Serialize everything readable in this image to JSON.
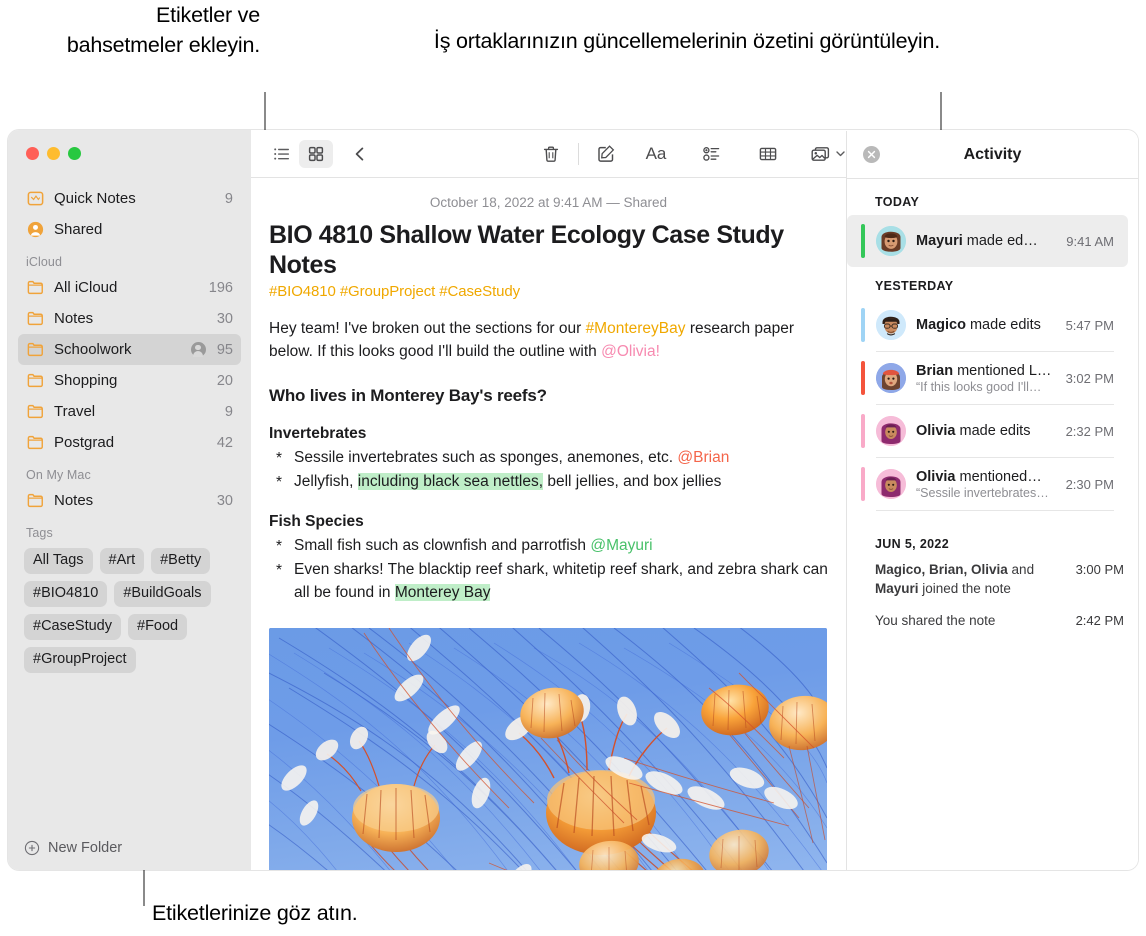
{
  "callouts": {
    "tags": "Etiketler ve bahsetmeler ekleyin.",
    "activity": "İş ortaklarınızın güncellemelerinin özetini görüntüleyin.",
    "browse": "Etiketlerinize göz atın."
  },
  "sidebar": {
    "top_items": [
      {
        "label": "Quick Notes",
        "count": "9",
        "icon": "quick-note-icon"
      },
      {
        "label": "Shared",
        "count": "",
        "icon": "shared-person-icon"
      }
    ],
    "sections": [
      {
        "header": "iCloud",
        "items": [
          {
            "label": "All iCloud",
            "count": "196",
            "icon": "folder-icon",
            "shared": false,
            "selected": false
          },
          {
            "label": "Notes",
            "count": "30",
            "icon": "folder-icon",
            "shared": false,
            "selected": false
          },
          {
            "label": "Schoolwork",
            "count": "95",
            "icon": "folder-icon",
            "shared": true,
            "selected": true
          },
          {
            "label": "Shopping",
            "count": "20",
            "icon": "folder-icon",
            "shared": false,
            "selected": false
          },
          {
            "label": "Travel",
            "count": "9",
            "icon": "folder-icon",
            "shared": false,
            "selected": false
          },
          {
            "label": "Postgrad",
            "count": "42",
            "icon": "folder-icon",
            "shared": false,
            "selected": false
          }
        ]
      },
      {
        "header": "On My Mac",
        "items": [
          {
            "label": "Notes",
            "count": "30",
            "icon": "folder-icon",
            "shared": false,
            "selected": false
          }
        ]
      }
    ],
    "tags_header": "Tags",
    "tags": [
      "All Tags",
      "#Art",
      "#Betty",
      "#BIO4810",
      "#BuildGoals",
      "#CaseStudy",
      "#Food",
      "#GroupProject"
    ],
    "new_folder_label": "New Folder"
  },
  "toolbar": {
    "list_view": "list-view-icon",
    "grid_view": "grid-view-icon",
    "back": "back-chevron-icon",
    "delete": "trash-icon",
    "compose": "compose-icon",
    "format": "Aa",
    "checklist": "checklist-icon",
    "table": "table-icon",
    "media": "media-icon",
    "link": "link-icon",
    "lock": "lock-icon",
    "collaborate": "add-person-icon",
    "share": "share-icon",
    "search": "search-icon"
  },
  "note": {
    "date": "October 18, 2022 at 9:41 AM — Shared",
    "title": "BIO 4810 Shallow Water Ecology Case Study Notes",
    "tags_line": "#BIO4810 #GroupProject #CaseStudy",
    "intro": {
      "part1": "Hey team! I've broken out the sections for our ",
      "tag": "#MontereyBay",
      "part2": " research paper below. If this looks good I'll build the outline with ",
      "mention": "@Olivia!"
    },
    "heading": "Who lives in Monterey Bay's reefs?",
    "sections": [
      {
        "subhead": "Invertebrates",
        "bullets": [
          {
            "pre": "Sessile invertebrates such as sponges, anemones, etc. ",
            "mention": "@Brian",
            "mention_color": "red",
            "post": ""
          },
          {
            "pre": "Jellyfish, ",
            "highlight": "including black sea nettles,",
            "post": " bell jellies, and box jellies"
          }
        ]
      },
      {
        "subhead": "Fish Species",
        "bullets": [
          {
            "pre": "Small fish such as clownfish and parrotfish ",
            "mention": "@Mayuri",
            "mention_color": "green",
            "post": ""
          },
          {
            "pre": "Even sharks! The blacktip reef shark, whitetip reef shark, and zebra shark can all be found in ",
            "highlight": "Monterey Bay",
            "post": ""
          }
        ]
      }
    ],
    "photo_alt": "jellyfish-photo"
  },
  "activity": {
    "title": "Activity",
    "close": "close-icon",
    "groups": [
      {
        "title": "TODAY",
        "entries": [
          {
            "type": "avatar",
            "name": "Mayuri",
            "action": " made ed…",
            "quote": "",
            "time": "9:41 AM",
            "bar_color": "#34c759",
            "avatar_bg": "#a8dfe6",
            "selected": true,
            "divider": false
          }
        ]
      },
      {
        "title": "YESTERDAY",
        "entries": [
          {
            "type": "avatar",
            "name": "Magico",
            "action": " made edits",
            "quote": "",
            "time": "5:47 PM",
            "bar_color": "#9fd4f5",
            "avatar_bg": "#cfe9fb",
            "selected": false,
            "divider": true
          },
          {
            "type": "avatar",
            "name": "Brian",
            "action": " mentioned L…",
            "quote": "“If this looks good I'll…",
            "time": "3:02 PM",
            "bar_color": "#f4543c",
            "avatar_bg": "#8fa8e8",
            "selected": false,
            "divider": true
          },
          {
            "type": "avatar",
            "name": "Olivia",
            "action": " made edits",
            "quote": "",
            "time": "2:32 PM",
            "bar_color": "#f9aac8",
            "avatar_bg": "#f6bcd8",
            "selected": false,
            "divider": true
          },
          {
            "type": "avatar",
            "name": "Olivia",
            "action": " mentioned…",
            "quote": "“Sessile invertebrates…",
            "time": "2:30 PM",
            "bar_color": "#f9aac8",
            "avatar_bg": "#f6bcd8",
            "selected": false,
            "divider": true
          }
        ]
      },
      {
        "title": "JUN 5, 2022",
        "entries": [
          {
            "type": "plain",
            "bold_names": "Magico, Brian, Olivia",
            "mid": " and ",
            "bold_names2": "Mayuri",
            "tail": " joined the note",
            "time": "3:00 PM"
          },
          {
            "type": "plain",
            "bold_names": "",
            "mid": "",
            "bold_names2": "",
            "tail": "You shared the note",
            "time": "2:42 PM"
          }
        ]
      }
    ]
  }
}
